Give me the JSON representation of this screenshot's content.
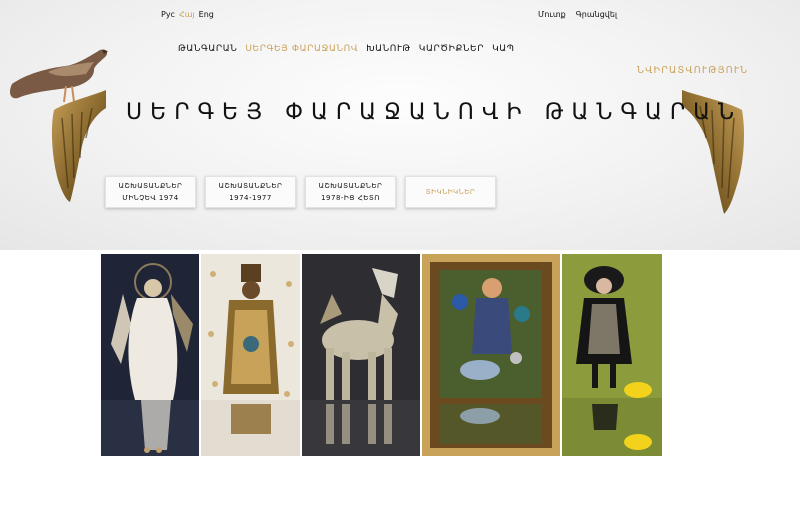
{
  "lang_switch": {
    "items": [
      "Рус",
      "Հայ",
      "Eng"
    ],
    "active_index": 1
  },
  "auth": {
    "login": "Մուտք",
    "register": "Գրանցվել"
  },
  "nav": {
    "items": [
      "ԹԱՆԳԱՐԱՆ",
      "ՍԵՐԳԵՅ ՓԱՐԱՋԱՆՈՎ",
      "ԽԱՆՈՒԹ",
      "ԿԱՐԾԻՔՆԵՐ",
      "ԿԱՊ"
    ],
    "active_index": 1
  },
  "donate_label": "ՆՎԻՐԱՏՎՈՒԹՅՈՒՆ",
  "site_title": "ՍԵՐԳԵՅ ՓԱՐԱՋԱՆՈՎԻ ԹԱՆԳԱՐԱՆ",
  "tiles": [
    {
      "line1": "ԱՇԽԱՏԱՆՔՆԵՐ",
      "line2": "ՄԻՆՉԵՎ 1974"
    },
    {
      "line1": "ԱՇԽԱՏԱՆՔՆԵՐ",
      "line2": "1974-1977"
    },
    {
      "line1": "ԱՇԽԱՏԱՆՔՆԵՐ",
      "line2": "1978-ԻՑ ՀԵՏՈ"
    },
    {
      "line1": "ՏԻԿՆԻԿՆԵՐ",
      "line2": ""
    }
  ],
  "active_tile_index": 3,
  "colors": {
    "accent": "#c9a25a",
    "text": "#111111",
    "hero_bg": "#f2f2f2"
  },
  "gallery": [
    {
      "icon": "white-doll-artwork-image",
      "bg": "#1c2233"
    },
    {
      "icon": "golden-doll-artwork-image",
      "bg": "#e9e5da"
    },
    {
      "icon": "toy-horse-artwork-image",
      "bg": "#3d3d40"
    },
    {
      "icon": "framed-collage-artwork-image",
      "bg": "#6b4a1f"
    },
    {
      "icon": "black-puppet-artwork-image",
      "bg": "#8a9a3a"
    }
  ]
}
